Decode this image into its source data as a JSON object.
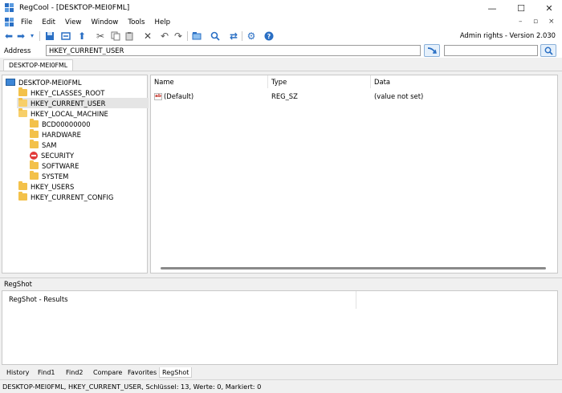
{
  "window": {
    "title": "RegCool - [DESKTOP-MEI0FML]",
    "minimize_glyph": "—",
    "maximize_glyph": "☐",
    "close_glyph": "✕"
  },
  "menu": {
    "items": [
      "File",
      "Edit",
      "View",
      "Window",
      "Tools",
      "Help"
    ],
    "mdi_minimize": "–",
    "mdi_restore": "▫",
    "mdi_close": "×"
  },
  "toolbar": {
    "version_text": "Admin rights - Version 2.030",
    "icons": [
      "back-icon",
      "forward-icon",
      "dropdown-icon",
      "save-icon",
      "export-icon",
      "up-icon",
      "cut-icon",
      "copy-icon",
      "paste-icon",
      "delete-icon",
      "undo-icon",
      "redo-icon",
      "new-key-icon",
      "find-icon",
      "refresh-icon",
      "settings-icon",
      "help-icon"
    ]
  },
  "address": {
    "label": "Address",
    "value": "HKEY_CURRENT_USER",
    "search_value": ""
  },
  "computer_tab": {
    "label": "DESKTOP-MEI0FML"
  },
  "tree": {
    "root": "DESKTOP-MEI0FML",
    "items": [
      {
        "label": "HKEY_CLASSES_ROOT"
      },
      {
        "label": "HKEY_CURRENT_USER"
      },
      {
        "label": "HKEY_LOCAL_MACHINE"
      },
      {
        "label": "BCD00000000"
      },
      {
        "label": "HARDWARE"
      },
      {
        "label": "SAM"
      },
      {
        "label": "SECURITY"
      },
      {
        "label": "SOFTWARE"
      },
      {
        "label": "SYSTEM"
      },
      {
        "label": "HKEY_USERS"
      },
      {
        "label": "HKEY_CURRENT_CONFIG"
      }
    ]
  },
  "list": {
    "columns": [
      "Name",
      "Type",
      "Data"
    ],
    "rows": [
      {
        "icon": "ab",
        "name": "(Default)",
        "type": "REG_SZ",
        "data": "(value not set)"
      }
    ]
  },
  "regshot": {
    "title": "RegShot",
    "results": "RegShot - Results"
  },
  "bottom_tabs": [
    "History",
    "Find1",
    "Find2",
    "Compare",
    "Favorites",
    "RegShot"
  ],
  "status": {
    "text": "DESKTOP-MEI0FML, HKEY_CURRENT_USER, Schlüssel: 13, Werte: 0, Markiert: 0"
  },
  "colors": {
    "accent": "#2a6fc4",
    "folder": "#f3c14a",
    "selection": "#e5e5e5",
    "security": "#e23c3c"
  }
}
